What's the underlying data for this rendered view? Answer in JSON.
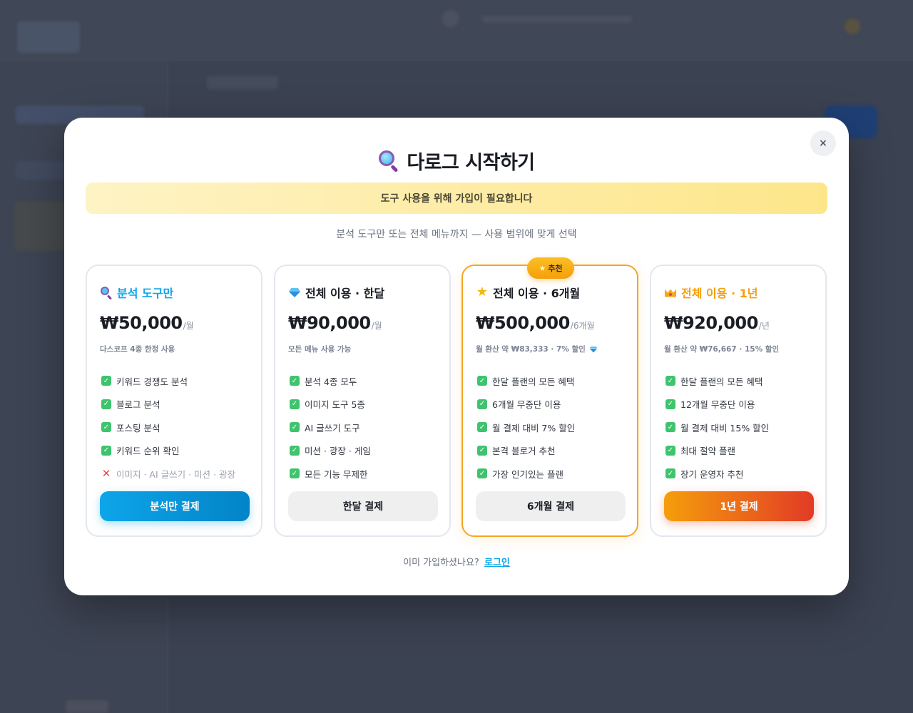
{
  "modal": {
    "title": "다로그 시작하기",
    "close_label": "×",
    "notice": "도구 사용을 위해 가입이 필요합니다",
    "subtitle": "분석 도구만 또는 전체 메뉴까지 — 사용 범위에 맞게 선택",
    "footer": {
      "question": "이미 가입하셨나요?",
      "login_label": "로그인"
    }
  },
  "plans": [
    {
      "name": "분석 도구만",
      "icon": "magnifier-icon",
      "accent": "#0ea5e9",
      "price": "₩50,000",
      "period": "/월",
      "description": "다스코프 4종 한정 사용",
      "features": [
        {
          "text": "키워드 경쟁도 분석",
          "included": true
        },
        {
          "text": "블로그 분석",
          "included": true
        },
        {
          "text": "포스팅 분석",
          "included": true
        },
        {
          "text": "키워드 순위 확인",
          "included": true
        },
        {
          "text": "이미지 · AI 글쓰기 · 미션 · 광장",
          "included": false
        }
      ],
      "button": "분석만 결제"
    },
    {
      "name": "전체 이용 · 한달",
      "icon": "gem-icon",
      "accent": "#1a1d24",
      "price": "₩90,000",
      "period": "/월",
      "description": "모든 메뉴 사용 가능",
      "features": [
        {
          "text": "분석 4종 모두",
          "included": true
        },
        {
          "text": "이미지 도구 5종",
          "included": true
        },
        {
          "text": "AI 글쓰기 도구",
          "included": true
        },
        {
          "text": "미션 · 광장 · 게임",
          "included": true
        },
        {
          "text": "모든 기능 무제한",
          "included": true
        }
      ],
      "button": "한달 결제"
    },
    {
      "name": "전체 이용 · 6개월",
      "icon": "star-icon",
      "accent": "#f5a623",
      "badge": "추천",
      "price": "₩500,000",
      "period": "/6개월",
      "description": "월 환산 약 ₩83,333 · 7% 할인",
      "features": [
        {
          "text": "한달 플랜의 모든 혜택",
          "included": true
        },
        {
          "text": "6개월 무중단 이용",
          "included": true
        },
        {
          "text": "월 결제 대비 7% 할인",
          "included": true
        },
        {
          "text": "본격 블로거 추천",
          "included": true
        },
        {
          "text": "가장 인기있는 플랜",
          "included": true
        }
      ],
      "button": "6개월 결제"
    },
    {
      "name": "전체 이용 · 1년",
      "icon": "crown-icon",
      "accent": "#f59e0b",
      "price": "₩920,000",
      "period": "/년",
      "description": "월 환산 약 ₩76,667 · 15% 할인",
      "features": [
        {
          "text": "한달 플랜의 모든 혜택",
          "included": true
        },
        {
          "text": "12개월 무중단 이용",
          "included": true
        },
        {
          "text": "월 결제 대비 15% 할인",
          "included": true
        },
        {
          "text": "최대 절약 플랜",
          "included": true
        },
        {
          "text": "장기 운영자 추천",
          "included": true
        }
      ],
      "button": "1년 결제"
    }
  ]
}
